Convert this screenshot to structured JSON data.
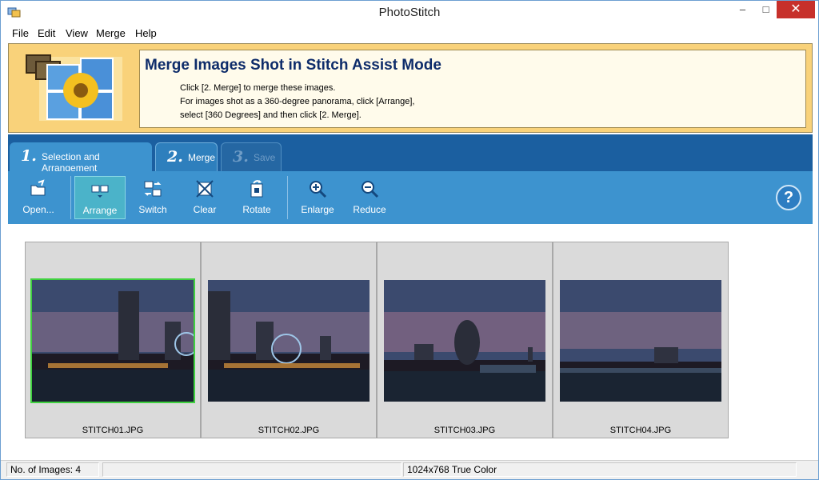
{
  "window": {
    "title": "PhotoStitch",
    "minimize": "–",
    "maximize": "□",
    "close": "✕"
  },
  "menu": [
    "File",
    "Edit",
    "View",
    "Merge",
    "Help"
  ],
  "banner": {
    "title": "Merge Images Shot in Stitch Assist Mode",
    "lines": [
      "Click [2.  Merge] to merge these images.",
      "For images shot as a 360-degree panorama, click [Arrange],",
      "select [360 Degrees] and then click [2. Merge]."
    ]
  },
  "tabs": [
    {
      "num": "1.",
      "label": "Selection and Arrangement",
      "state": "active"
    },
    {
      "num": "2.",
      "label": "Merge",
      "state": "enabled"
    },
    {
      "num": "3.",
      "label": "Save",
      "state": "disabled"
    }
  ],
  "toolbar": {
    "open": "Open...",
    "arrange": "Arrange",
    "switch": "Switch",
    "clear": "Clear",
    "rotate": "Rotate",
    "enlarge": "Enlarge",
    "reduce": "Reduce",
    "help": "?"
  },
  "images": [
    {
      "name": "STITCH01.JPG",
      "selected": true
    },
    {
      "name": "STITCH02.JPG",
      "selected": false
    },
    {
      "name": "STITCH03.JPG",
      "selected": false
    },
    {
      "name": "STITCH04.JPG",
      "selected": false
    }
  ],
  "status": {
    "count": "No. of Images: 4",
    "middle": "",
    "resolution": "1024x768 True Color"
  },
  "colors": {
    "accent": "#1b5fa0",
    "toolbar": "#3d93cf",
    "banner": "#f9d27a",
    "selection": "#3fd13f"
  }
}
